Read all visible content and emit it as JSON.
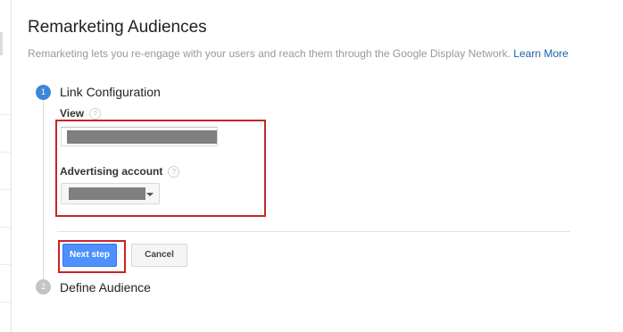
{
  "header": {
    "title": "Remarketing Audiences",
    "description": "Remarketing lets you re-engage with your users and reach them through the Google Display Network.",
    "learn_more_link": "Learn More"
  },
  "steps": [
    {
      "number": "1",
      "title": "Link Configuration",
      "state": "active"
    },
    {
      "number": "2",
      "title": "Define Audience",
      "state": "inactive"
    }
  ],
  "form": {
    "view_label": "View",
    "view_value": "[redacted]",
    "advertising_account_label": "Advertising account",
    "advertising_account_value": "[redacted]",
    "help_glyph": "?"
  },
  "buttons": {
    "next_step": "Next step",
    "cancel": "Cancel"
  },
  "colors": {
    "active_step": "#3d87d8",
    "inactive_step": "#c3c3c3",
    "primary_button": "#4d90fe",
    "link": "#1a5fa8",
    "highlight": "#c9232a"
  }
}
